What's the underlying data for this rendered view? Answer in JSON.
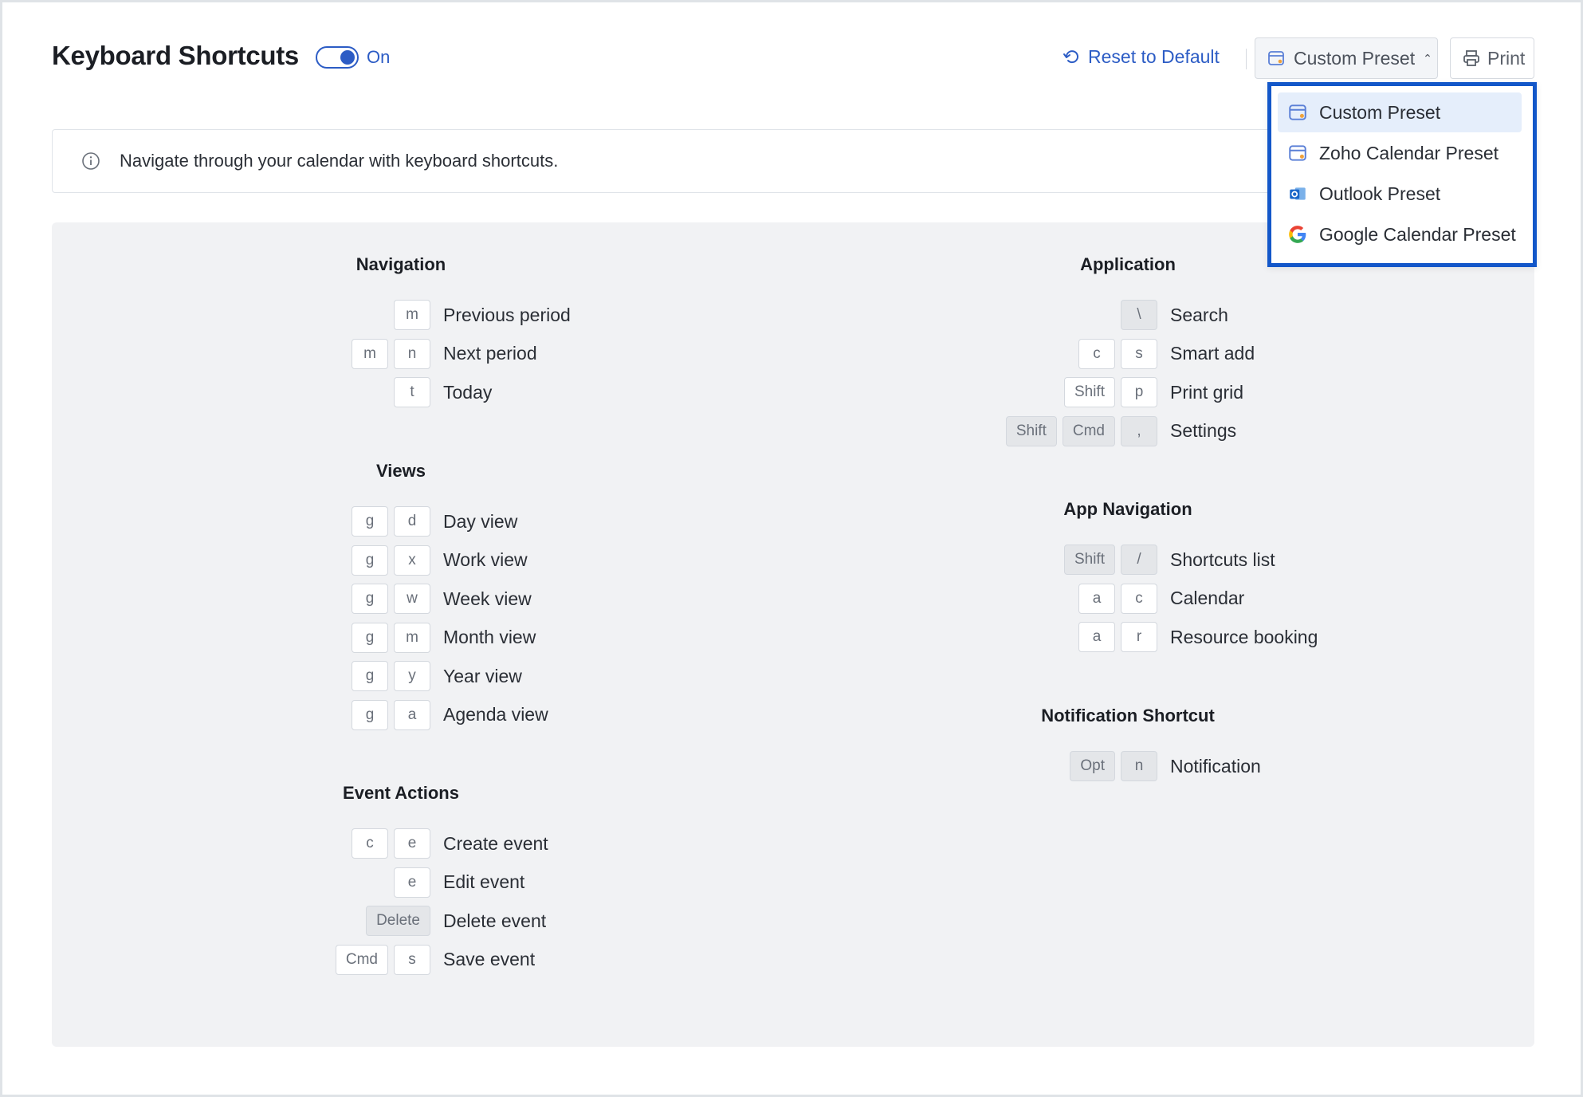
{
  "header": {
    "title": "Keyboard Shortcuts",
    "toggle_label": "On",
    "toggle_on": true,
    "reset_label": "Reset to Default",
    "preset_label": "Custom Preset",
    "print_label": "Print"
  },
  "info": {
    "text": "Navigate through your calendar with keyboard shortcuts."
  },
  "dropdown": {
    "items": [
      {
        "label": "Custom Preset",
        "icon": "custom-preset-icon",
        "selected": true
      },
      {
        "label": "Zoho Calendar Preset",
        "icon": "zoho-calendar-icon",
        "selected": false
      },
      {
        "label": "Outlook Preset",
        "icon": "outlook-icon",
        "selected": false
      },
      {
        "label": "Google Calendar Preset",
        "icon": "google-icon",
        "selected": false
      }
    ]
  },
  "sections": {
    "navigation": {
      "title": "Navigation",
      "rows": [
        {
          "keys": [
            "m"
          ],
          "label": "Previous period"
        },
        {
          "keys": [
            "m",
            "n"
          ],
          "label": "Next period"
        },
        {
          "keys": [
            "t"
          ],
          "label": "Today"
        }
      ]
    },
    "views": {
      "title": "Views",
      "rows": [
        {
          "keys": [
            "g",
            "d"
          ],
          "label": "Day view"
        },
        {
          "keys": [
            "g",
            "x"
          ],
          "label": "Work view"
        },
        {
          "keys": [
            "g",
            "w"
          ],
          "label": "Week view"
        },
        {
          "keys": [
            "g",
            "m"
          ],
          "label": "Month view"
        },
        {
          "keys": [
            "g",
            "y"
          ],
          "label": "Year view"
        },
        {
          "keys": [
            "g",
            "a"
          ],
          "label": "Agenda view"
        }
      ]
    },
    "event_actions": {
      "title": "Event Actions",
      "rows": [
        {
          "keys": [
            "c",
            "e"
          ],
          "label": "Create event"
        },
        {
          "keys": [
            "e"
          ],
          "label": "Edit event"
        },
        {
          "keys": [
            "Delete"
          ],
          "label": "Delete event",
          "gray": true
        },
        {
          "keys": [
            "Cmd",
            "s"
          ],
          "label": "Save event"
        }
      ]
    },
    "application": {
      "title": "Application",
      "rows": [
        {
          "keys": [
            "\\"
          ],
          "label": "Search",
          "gray": true
        },
        {
          "keys": [
            "c",
            "s"
          ],
          "label": "Smart add"
        },
        {
          "keys": [
            "Shift",
            "p"
          ],
          "label": "Print grid"
        },
        {
          "keys": [
            "Shift",
            "Cmd",
            ","
          ],
          "label": "Settings",
          "gray": true
        }
      ]
    },
    "app_navigation": {
      "title": "App Navigation",
      "rows": [
        {
          "keys": [
            "Shift",
            "/"
          ],
          "label": "Shortcuts list",
          "gray": true
        },
        {
          "keys": [
            "a",
            "c"
          ],
          "label": "Calendar"
        },
        {
          "keys": [
            "a",
            "r"
          ],
          "label": "Resource booking"
        }
      ]
    },
    "notification": {
      "title": "Notification Shortcut",
      "rows": [
        {
          "keys": [
            "Opt",
            "n"
          ],
          "label": "Notification",
          "gray": true
        }
      ]
    }
  },
  "colors": {
    "accent": "#2c5cc5",
    "dropdown_border": "#1357c9",
    "panel_bg": "#f1f2f4"
  }
}
